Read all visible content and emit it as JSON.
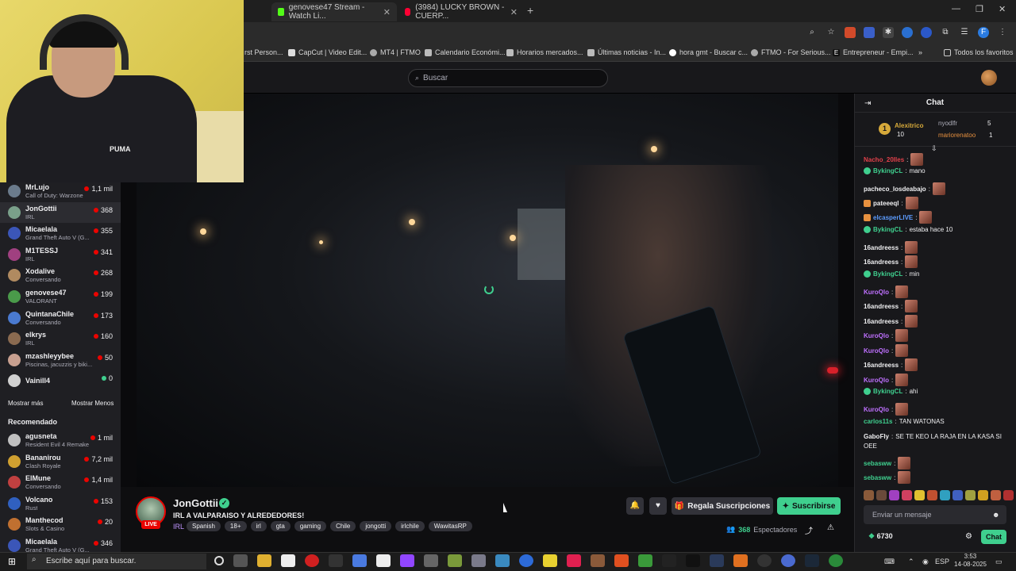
{
  "browser": {
    "tabs": [
      {
        "label": "genovese47 Stream - Watch Li..."
      },
      {
        "label": "(3984) LUCKY BROWN - CUERP..."
      }
    ],
    "bookmarks": [
      {
        "label": "rst Person..."
      },
      {
        "label": "CapCut | Video Edit..."
      },
      {
        "label": "MT4 | FTMO"
      },
      {
        "label": "Calendario Económi..."
      },
      {
        "label": "Horarios mercados..."
      },
      {
        "label": "Últimas noticias - In..."
      },
      {
        "label": "hora gmt - Buscar c..."
      },
      {
        "label": "FTMO - For Serious..."
      },
      {
        "label": "Entrepreneur - Empi..."
      },
      {
        "label": "Todos los favoritos"
      }
    ]
  },
  "nav": {
    "search_placeholder": "Buscar"
  },
  "webcam": {
    "shirt_logo": "PUMA"
  },
  "sidebar": {
    "followed": [
      {
        "name": "MrLujo",
        "category": "Call of Duty: Warzone",
        "viewers": "1,1 mil",
        "color": "#6b7b8c"
      },
      {
        "name": "JonGottii",
        "category": "IRL",
        "viewers": "368",
        "color": "#7aa08a"
      },
      {
        "name": "Micaelala",
        "category": "Grand Theft Auto V (G...",
        "viewers": "355",
        "color": "#3b56b8"
      },
      {
        "name": "M1TESSJ",
        "category": "IRL",
        "viewers": "341",
        "color": "#a04080"
      },
      {
        "name": "Xodalive",
        "category": "Conversando",
        "viewers": "268",
        "color": "#b08a60"
      },
      {
        "name": "genovese47",
        "category": "VALORANT",
        "viewers": "199",
        "color": "#4a9a4a"
      },
      {
        "name": "QuintanaChile",
        "category": "Conversando",
        "viewers": "173",
        "color": "#4a7ad0"
      },
      {
        "name": "elkrys",
        "category": "IRL",
        "viewers": "160",
        "color": "#8a6a50"
      },
      {
        "name": "mzashleyybee",
        "category": "Piscinas, jacuzzis y biki...",
        "viewers": "50",
        "color": "#c8a090"
      },
      {
        "name": "Vainill4",
        "category": "",
        "viewers": "0",
        "color": "#d0d0d0"
      }
    ],
    "show_more": "Mostrar más",
    "show_less": "Mostrar Menos",
    "recommended_heading": "Recomendado",
    "recommended": [
      {
        "name": "agusneta",
        "category": "Resident Evil 4 Remake",
        "viewers": "1 mil",
        "color": "#c0c0c0"
      },
      {
        "name": "Bananirou",
        "category": "Clash Royale",
        "viewers": "7,2 mil",
        "color": "#d0a030"
      },
      {
        "name": "ElMune",
        "category": "Conversando",
        "viewers": "1,4 mil",
        "color": "#c04040"
      },
      {
        "name": "Volcano",
        "category": "Rust",
        "viewers": "153",
        "color": "#3060c0"
      },
      {
        "name": "Manthecod",
        "category": "Slots & Casino",
        "viewers": "20",
        "color": "#c07030"
      },
      {
        "name": "Micaelala",
        "category": "Grand Theft Auto V (G...",
        "viewers": "346",
        "color": "#3b56b8"
      }
    ]
  },
  "channel": {
    "live_badge": "LIVE",
    "name": "JonGottii",
    "title": "IRL A VALPARAISO Y ALREDEDORES!",
    "category": "IRL",
    "tags": [
      "Spanish",
      "18+",
      "irl",
      "gta",
      "gaming",
      "Chile",
      "jongotti",
      "irlchile",
      "WawitasRP"
    ],
    "gift_label": "Regala Suscripciones",
    "subscribe_label": "Suscribirse",
    "viewers": "368",
    "viewers_label": "Espectadores"
  },
  "chat": {
    "title": "Chat",
    "leaders": {
      "first": {
        "rank": "1",
        "name": "Alexitrico",
        "count": "10"
      },
      "second": {
        "name": "nyodlfr",
        "count": "5"
      },
      "third": {
        "name": "mariorenatoo",
        "count": "1"
      }
    },
    "messages": [
      {
        "user": "Nacho_20Iles",
        "color": "#e0404a",
        "text": "",
        "emote": true,
        "verified": false
      },
      {
        "user": "BykingCL",
        "color": "#3fcf8e",
        "text": "mano",
        "emote": false,
        "verified": true
      },
      {
        "user": "pacheco_losdeabajo",
        "color": "#efeff1",
        "text": "",
        "emote": true,
        "verified": false
      },
      {
        "user": "pateeeql",
        "color": "#efeff1",
        "text": "",
        "emote": true,
        "verified": false
      },
      {
        "user": "elcasperLIVE",
        "color": "#5c9cff",
        "text": "",
        "emote": true,
        "verified": false
      },
      {
        "user": "BykingCL",
        "color": "#3fcf8e",
        "text": "estaba hace 10",
        "emote": false,
        "verified": true
      },
      {
        "user": "16andreess",
        "color": "#efeff1",
        "text": "",
        "emote": true,
        "verified": false
      },
      {
        "user": "16andreess",
        "color": "#efeff1",
        "text": "",
        "emote": true,
        "verified": false
      },
      {
        "user": "BykingCL",
        "color": "#3fcf8e",
        "text": "min",
        "emote": false,
        "verified": true
      },
      {
        "user": "KuroQlo",
        "color": "#bf70ff",
        "text": "",
        "emote": true,
        "verified": false
      },
      {
        "user": "16andreess",
        "color": "#efeff1",
        "text": "",
        "emote": true,
        "verified": false
      },
      {
        "user": "16andreess",
        "color": "#efeff1",
        "text": "",
        "emote": true,
        "verified": false
      },
      {
        "user": "KuroQlo",
        "color": "#bf70ff",
        "text": "",
        "emote": true,
        "verified": false
      },
      {
        "user": "KuroQlo",
        "color": "#bf70ff",
        "text": "",
        "emote": true,
        "verified": false
      },
      {
        "user": "16andreess",
        "color": "#efeff1",
        "text": "",
        "emote": true,
        "verified": false
      },
      {
        "user": "KuroQlo",
        "color": "#bf70ff",
        "text": "",
        "emote": true,
        "verified": false
      },
      {
        "user": "BykingCL",
        "color": "#3fcf8e",
        "text": "ahi",
        "emote": false,
        "verified": true
      },
      {
        "user": "KuroQlo",
        "color": "#bf70ff",
        "text": "",
        "emote": true,
        "verified": false
      },
      {
        "user": "carlos11s",
        "color": "#3fcf8e",
        "text": "TAN WATONAS",
        "emote": false,
        "verified": false
      },
      {
        "user": "GaboFly",
        "color": "#efeff1",
        "text": "SE TE KEO LA RAJA EN LA KASA SI",
        "text2": "OEE",
        "emote": false,
        "verified": false
      },
      {
        "user": "sebasww",
        "color": "#3fcf8e",
        "text": "",
        "emote": true,
        "verified": false
      },
      {
        "user": "sebasww",
        "color": "#3fcf8e",
        "text": "",
        "emote": true,
        "verified": false
      }
    ],
    "input_placeholder": "Enviar un mensaje",
    "points": "6730",
    "chat_button": "Chat"
  },
  "taskbar": {
    "search_placeholder": "Escribe aquí para buscar.",
    "language": "ESP",
    "time": "3:53",
    "date": "14-08-2025"
  }
}
